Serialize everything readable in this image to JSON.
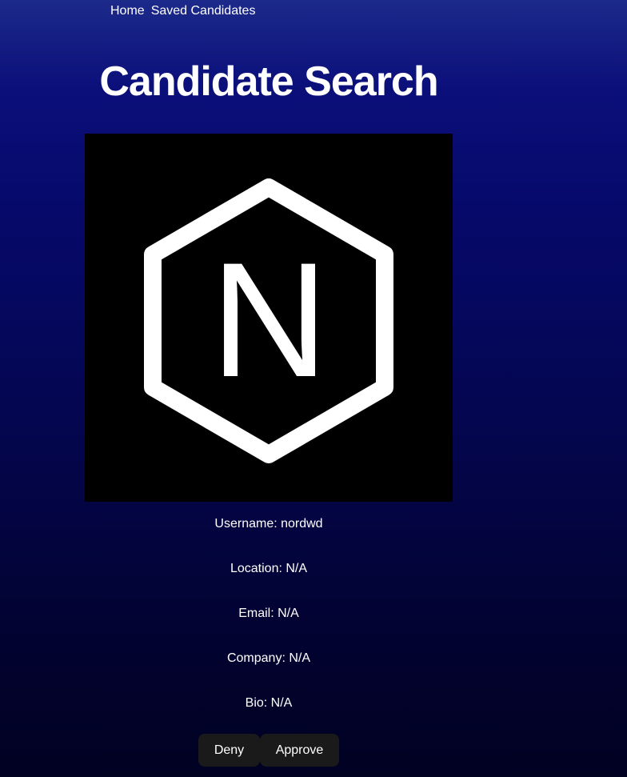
{
  "nav": {
    "home": "Home",
    "saved": "Saved Candidates"
  },
  "page": {
    "title": "Candidate Search"
  },
  "candidate": {
    "avatar_letter": "N",
    "username": "Username: nordwd",
    "location": "Location: N/A",
    "email": "Email: N/A",
    "company": "Company: N/A",
    "bio": "Bio: N/A"
  },
  "actions": {
    "deny": "Deny",
    "approve": "Approve"
  },
  "colors": {
    "button_bg": "#1a1a1a",
    "text": "#ffffff",
    "avatar_bg": "#000000"
  }
}
